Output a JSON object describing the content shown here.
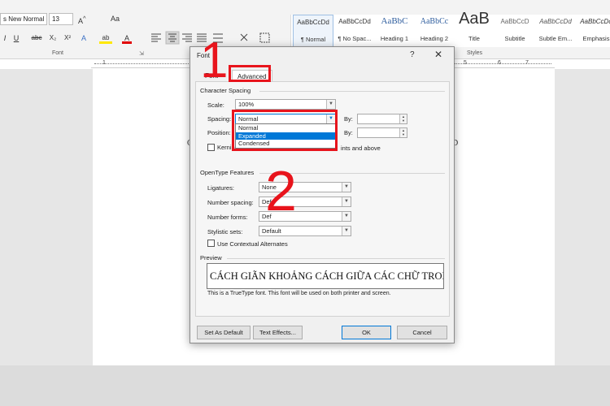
{
  "ribbon": {
    "font_name": "s New Normal",
    "font_size": "13",
    "font_group_label": "Font",
    "styles_group_label": "Styles",
    "format_buttons": [
      "I",
      "U",
      "abc",
      "X₂",
      "X²",
      "A",
      "ab",
      "A"
    ],
    "styles": [
      {
        "preview": "AaBbCcDd",
        "name": "¶ Normal",
        "selected": true
      },
      {
        "preview": "AaBbCcDd",
        "name": "¶ No Spac..."
      },
      {
        "preview": "AaBbC",
        "name": "Heading 1"
      },
      {
        "preview": "AaBbCc",
        "name": "Heading 2"
      },
      {
        "preview": "AaB",
        "name": "Title"
      },
      {
        "preview": "AaBbCcD",
        "name": "Subtitle"
      },
      {
        "preview": "AaBbCcDd",
        "name": "Subtle Em..."
      },
      {
        "preview": "AaBbCcDd",
        "name": "Emphasis"
      }
    ]
  },
  "ruler": {
    "numbers": [
      "1",
      "5",
      "6",
      "7"
    ]
  },
  "document": {
    "glyph_left": "C",
    "glyph_right": "D"
  },
  "dialog": {
    "title": "Font",
    "help": "?",
    "close": "✕",
    "tabs": {
      "font": "Font",
      "advanced": "Advanced"
    },
    "character_spacing": {
      "section": "Character Spacing",
      "scale_label": "Scale:",
      "scale_value": "100%",
      "spacing_label": "Spacing:",
      "spacing_value": "Normal",
      "spacing_options": [
        "Normal",
        "Expanded",
        "Condensed"
      ],
      "highlighted_option": "Expanded",
      "by_label": "By:",
      "position_label": "Position:",
      "kerning_label": "Kerning for fonts:",
      "kerning_tail": "ints and above"
    },
    "opentype": {
      "section": "OpenType Features",
      "ligatures_label": "Ligatures:",
      "ligatures_value": "None",
      "number_spacing_label": "Number spacing:",
      "number_spacing_value": "Defa",
      "number_forms_label": "Number forms:",
      "number_forms_value": "Def",
      "stylistic_sets_label": "Stylistic sets:",
      "stylistic_sets_value": "Default",
      "contextual_label": "Use Contextual Alternates"
    },
    "preview": {
      "section": "Preview",
      "sample": "CÁCH GIÃN KHOẢNG CÁCH GIỮA CÁC CHỮ TRON",
      "note": "This is a TrueType font. This font will be used on both printer and screen."
    },
    "buttons": {
      "set_default": "Set As Default",
      "text_effects": "Text Effects...",
      "ok": "OK",
      "cancel": "Cancel"
    }
  },
  "annotations": {
    "step1": "1",
    "step2": "2"
  },
  "colors": {
    "annotation_red": "#e8141c",
    "highlight_blue": "#0078d7"
  }
}
